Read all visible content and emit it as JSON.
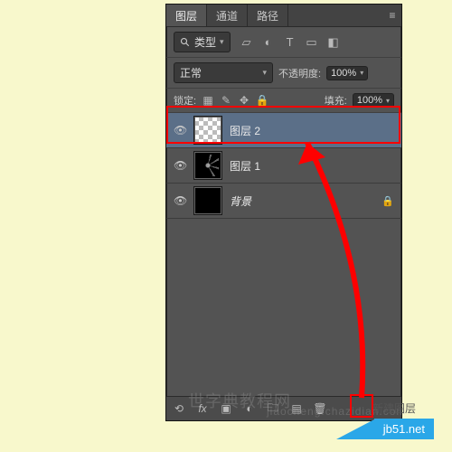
{
  "tabs": [
    "图层",
    "通道",
    "路径"
  ],
  "filter": {
    "label": "类型"
  },
  "blend": {
    "mode": "正常",
    "opacity_label": "不透明度:",
    "opacity": "100%"
  },
  "lock": {
    "label": "锁定:",
    "fill_label": "填充:",
    "fill": "100%"
  },
  "layers": [
    {
      "name": "图层 2",
      "selected": true
    },
    {
      "name": "图层 1",
      "selected": false
    },
    {
      "name": "背景",
      "selected": false,
      "locked": true
    }
  ],
  "watermarks": [
    "世字典教程网",
    "jiaocheng.chazidian.com"
  ],
  "caption": "新建图层",
  "badge": "jb51.net"
}
